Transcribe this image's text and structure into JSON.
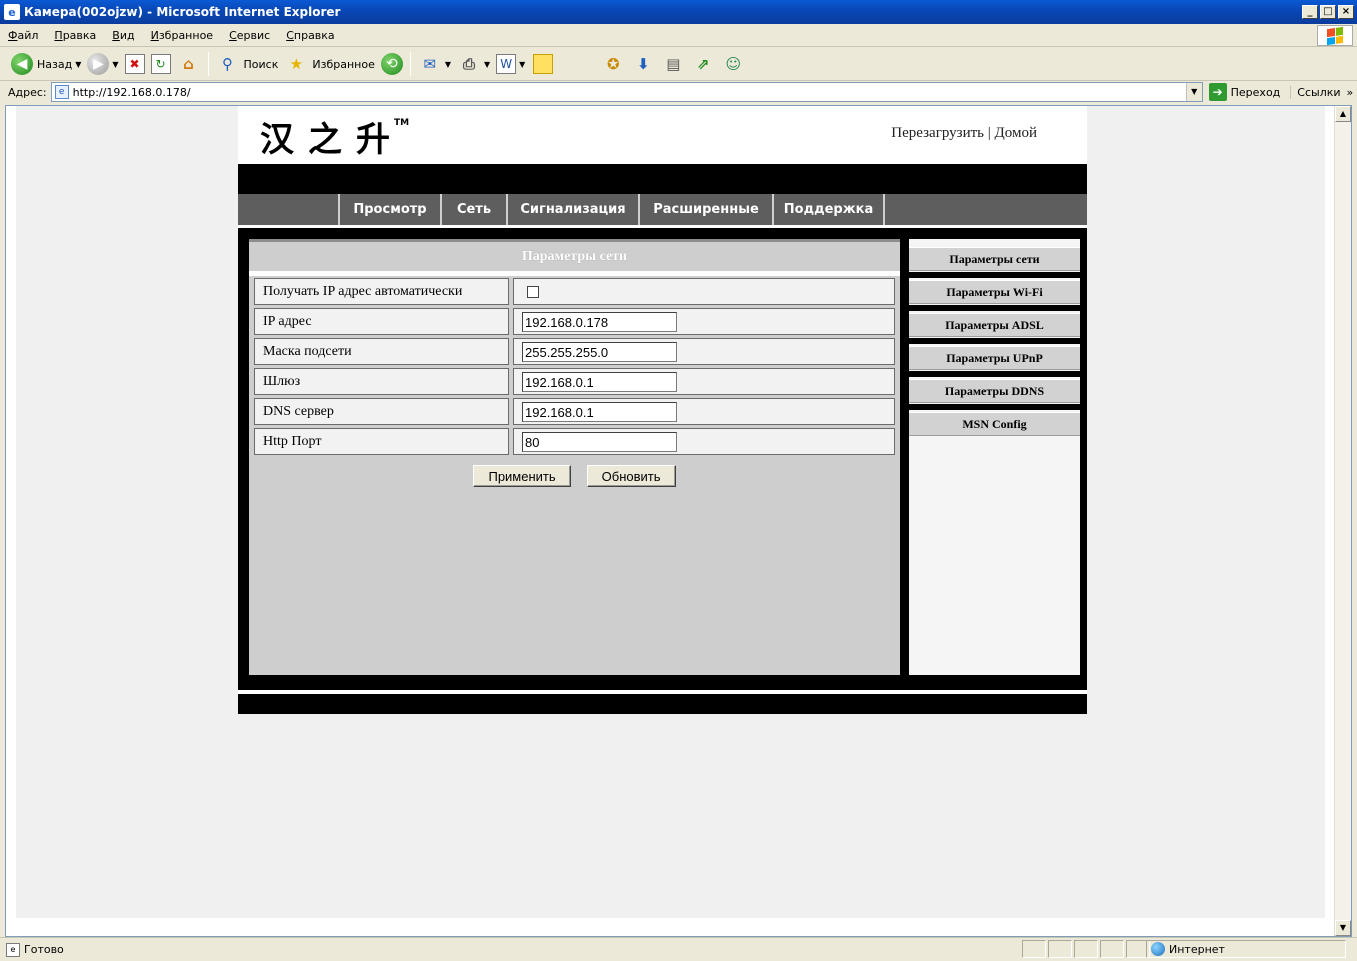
{
  "window": {
    "title": "Камера(002ojzw) - Microsoft Internet Explorer"
  },
  "menu": [
    {
      "label": "Файл",
      "ul": "Ф",
      "rest": "айл"
    },
    {
      "label": "Правка",
      "ul": "П",
      "rest": "равка"
    },
    {
      "label": "Вид",
      "ul": "В",
      "rest": "ид"
    },
    {
      "label": "Избранное",
      "ul": "И",
      "rest": "збранное"
    },
    {
      "label": "Сервис",
      "ul": "С",
      "rest": "ервис"
    },
    {
      "label": "Справка",
      "ul": "С",
      "rest": "правка"
    }
  ],
  "toolbar": {
    "back_label": "Назад",
    "search_label": "Поиск",
    "favorites_label": "Избранное"
  },
  "address": {
    "label": "Адрес:",
    "url": "http://192.168.0.178/",
    "go_label": "Переход",
    "links_label": "Ссылки"
  },
  "camera": {
    "logo": "汉之升",
    "logo_tm": "TM",
    "top_links": {
      "reboot": "Перезагрузить",
      "sep": "|",
      "home": "Домой"
    },
    "nav": [
      "Просмотр",
      "Сеть",
      "Сигнализация",
      "Расширенные",
      "Поддержка"
    ],
    "panel_title": "Параметры сети",
    "rows": [
      {
        "label": "Получать IP адрес автоматически",
        "type": "checkbox",
        "checked": false
      },
      {
        "label": "IP адрес",
        "type": "text",
        "value": "192.168.0.178"
      },
      {
        "label": "Маска подсети",
        "type": "text",
        "value": "255.255.255.0"
      },
      {
        "label": "Шлюз",
        "type": "text",
        "value": "192.168.0.1"
      },
      {
        "label": "DNS сервер",
        "type": "text",
        "value": "192.168.0.1"
      },
      {
        "label": "Http Порт",
        "type": "text",
        "value": "80"
      }
    ],
    "buttons": {
      "apply": "Применить",
      "refresh": "Обновить"
    },
    "side_menu": [
      "Параметры сети",
      "Параметры Wi-Fi",
      "Параметры ADSL",
      "Параметры UPnP",
      "Параметры DDNS",
      "MSN Config"
    ]
  },
  "status": {
    "text": "Готово",
    "zone": "Интернет"
  }
}
